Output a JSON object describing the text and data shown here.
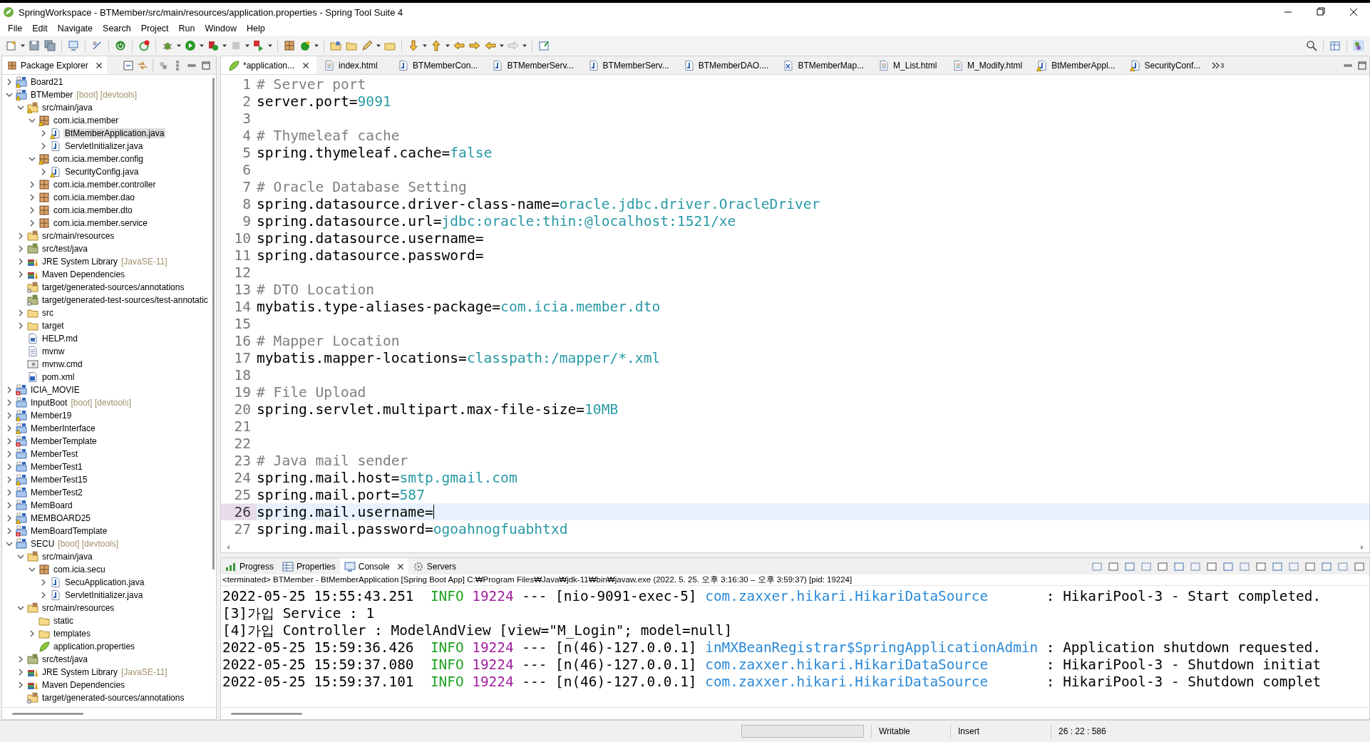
{
  "window": {
    "title": "SpringWorkspace - BTMember/src/main/resources/application.properties - Spring Tool Suite 4"
  },
  "menu": [
    "File",
    "Edit",
    "Navigate",
    "Search",
    "Project",
    "Run",
    "Window",
    "Help"
  ],
  "package_explorer": {
    "title": "Package Explorer",
    "tree": [
      {
        "label": "Board21",
        "kind": "project",
        "warning": true,
        "expanded": false,
        "selected": false
      },
      {
        "label": "BTMember",
        "decoration": "[boot] [devtools]",
        "kind": "project",
        "warning": true,
        "expanded": true,
        "selected": false,
        "children": [
          {
            "label": "src/main/java",
            "kind": "src-folder",
            "warning": true,
            "expanded": true,
            "selected": false,
            "children": [
              {
                "label": "com.icia.member",
                "kind": "package",
                "warning": true,
                "expanded": true,
                "selected": false,
                "children": [
                  {
                    "label": "BtMemberApplication.java",
                    "kind": "java",
                    "warning": true,
                    "expanded": false,
                    "selected": true
                  },
                  {
                    "label": "ServletInitializer.java",
                    "kind": "java",
                    "expanded": false,
                    "selected": false
                  }
                ]
              },
              {
                "label": "com.icia.member.config",
                "kind": "package",
                "warning": true,
                "expanded": true,
                "selected": false,
                "children": [
                  {
                    "label": "SecurityConfig.java",
                    "kind": "java",
                    "warning": true,
                    "expanded": false,
                    "selected": false
                  }
                ]
              },
              {
                "label": "com.icia.member.controller",
                "kind": "package",
                "expanded": false,
                "selected": false
              },
              {
                "label": "com.icia.member.dao",
                "kind": "package",
                "expanded": false,
                "selected": false
              },
              {
                "label": "com.icia.member.dto",
                "kind": "package",
                "expanded": false,
                "selected": false
              },
              {
                "label": "com.icia.member.service",
                "kind": "package",
                "expanded": false,
                "selected": false
              }
            ]
          },
          {
            "label": "src/main/resources",
            "kind": "src-folder",
            "expanded": false,
            "selected": false
          },
          {
            "label": "src/test/java",
            "kind": "test-folder",
            "expanded": false,
            "selected": false
          },
          {
            "label": "JRE System Library",
            "decoration": "[JavaSE-11]",
            "kind": "library",
            "expanded": false,
            "selected": false
          },
          {
            "label": "Maven Dependencies",
            "kind": "library",
            "expanded": false,
            "selected": false
          },
          {
            "label": "target/generated-sources/annotations",
            "kind": "gen-folder",
            "selected": false
          },
          {
            "label": "target/generated-test-sources/test-annotatic",
            "kind": "gen-test-folder",
            "selected": false
          },
          {
            "label": "src",
            "kind": "folder",
            "expanded": false,
            "selected": false
          },
          {
            "label": "target",
            "kind": "folder",
            "expanded": false,
            "selected": false
          },
          {
            "label": "HELP.md",
            "kind": "doc",
            "selected": false
          },
          {
            "label": "mvnw",
            "kind": "file",
            "selected": false
          },
          {
            "label": "mvnw.cmd",
            "kind": "cmd",
            "selected": false
          },
          {
            "label": "pom.xml",
            "kind": "pom",
            "selected": false
          }
        ]
      },
      {
        "label": "ICIA_MOVIE",
        "kind": "project",
        "error": true,
        "expanded": false,
        "selected": false
      },
      {
        "label": "InputBoot",
        "decoration": "[boot] [devtools]",
        "kind": "project",
        "expanded": false,
        "selected": false
      },
      {
        "label": "Member19",
        "kind": "project",
        "warning": true,
        "expanded": false,
        "selected": false
      },
      {
        "label": "MemberInterface",
        "kind": "project",
        "warning": true,
        "expanded": false,
        "selected": false
      },
      {
        "label": "MemberTemplate",
        "kind": "project",
        "error": true,
        "expanded": false,
        "selected": false
      },
      {
        "label": "MemberTest",
        "kind": "project",
        "expanded": false,
        "selected": false
      },
      {
        "label": "MemberTest1",
        "kind": "project",
        "expanded": false,
        "selected": false
      },
      {
        "label": "MemberTest15",
        "kind": "project",
        "warning": true,
        "expanded": false,
        "selected": false
      },
      {
        "label": "MemberTest2",
        "kind": "project",
        "expanded": false,
        "selected": false
      },
      {
        "label": "MemBoard",
        "kind": "project",
        "expanded": false,
        "selected": false
      },
      {
        "label": "MEMBOARD25",
        "kind": "project",
        "warning": true,
        "expanded": false,
        "selected": false
      },
      {
        "label": "MemBoardTemplate",
        "kind": "project",
        "error": true,
        "expanded": false,
        "selected": false
      },
      {
        "label": "SECU",
        "decoration": "[boot] [devtools]",
        "kind": "project",
        "expanded": true,
        "selected": false,
        "children": [
          {
            "label": "src/main/java",
            "kind": "src-folder",
            "expanded": true,
            "selected": false,
            "children": [
              {
                "label": "com.icia.secu",
                "kind": "package",
                "expanded": true,
                "selected": false,
                "children": [
                  {
                    "label": "SecuApplication.java",
                    "kind": "java",
                    "expanded": false,
                    "selected": false
                  },
                  {
                    "label": "ServletInitializer.java",
                    "kind": "java",
                    "expanded": false,
                    "selected": false
                  }
                ]
              }
            ]
          },
          {
            "label": "src/main/resources",
            "kind": "src-folder",
            "expanded": true,
            "selected": false,
            "children": [
              {
                "label": "static",
                "kind": "folder",
                "selected": false
              },
              {
                "label": "templates",
                "kind": "folder",
                "expanded": false,
                "selected": false
              },
              {
                "label": "application.properties",
                "kind": "leaf",
                "selected": false
              }
            ]
          },
          {
            "label": "src/test/java",
            "kind": "test-folder",
            "expanded": false,
            "selected": false
          },
          {
            "label": "JRE System Library",
            "decoration": "[JavaSE-11]",
            "kind": "library",
            "expanded": false,
            "selected": false
          },
          {
            "label": "Maven Dependencies",
            "kind": "library",
            "expanded": false,
            "selected": false
          },
          {
            "label": "target/generated-sources/annotations",
            "kind": "gen-folder",
            "selected": false
          }
        ]
      }
    ]
  },
  "editor": {
    "tabs": [
      {
        "label": "*application...",
        "kind": "leaf",
        "selected": true
      },
      {
        "label": "index.html",
        "kind": "html",
        "selected": false
      },
      {
        "label": "BTMemberCon...",
        "kind": "java",
        "selected": false
      },
      {
        "label": "BTMemberServ...",
        "kind": "java",
        "selected": false
      },
      {
        "label": "BTMemberServ...",
        "kind": "java",
        "selected": false
      },
      {
        "label": "BTMemberDAO....",
        "kind": "java",
        "selected": false
      },
      {
        "label": "BTMemberMap...",
        "kind": "xml",
        "selected": false
      },
      {
        "label": "M_List.html",
        "kind": "html",
        "selected": false
      },
      {
        "label": "M_Modify.html",
        "kind": "html",
        "selected": false
      },
      {
        "label": "BtMemberAppl...",
        "kind": "java",
        "warning": true,
        "selected": false
      },
      {
        "label": "SecurityConf...",
        "kind": "java",
        "warning": true,
        "selected": false
      }
    ],
    "overflow": "3",
    "lines": [
      {
        "number": "1",
        "kind": "comment",
        "text": "# Server port",
        "current": false
      },
      {
        "number": "2",
        "kind": "property",
        "key": "server.port=",
        "value": "9091",
        "current": false
      },
      {
        "number": "3",
        "kind": "blank",
        "current": false
      },
      {
        "number": "4",
        "kind": "comment",
        "text": "# Thymeleaf cache",
        "current": false
      },
      {
        "number": "5",
        "kind": "property",
        "key": "spring.thymeleaf.cache=",
        "value": "false",
        "current": false
      },
      {
        "number": "6",
        "kind": "blank",
        "current": false
      },
      {
        "number": "7",
        "kind": "comment",
        "text": "# Oracle Database Setting",
        "current": false
      },
      {
        "number": "8",
        "kind": "property",
        "key": "spring.datasource.driver-class-name=",
        "value": "oracle.jdbc.driver.OracleDriver",
        "current": false
      },
      {
        "number": "9",
        "kind": "property",
        "key": "spring.datasource.url=",
        "value": "jdbc:oracle:thin:@localhost:1521/xe",
        "current": false
      },
      {
        "number": "10",
        "kind": "property",
        "key": "spring.datasource.username=",
        "current": false
      },
      {
        "number": "11",
        "kind": "property",
        "key": "spring.datasource.password=",
        "current": false
      },
      {
        "number": "12",
        "kind": "blank",
        "current": false
      },
      {
        "number": "13",
        "kind": "comment",
        "text": "# DTO Location",
        "current": false
      },
      {
        "number": "14",
        "kind": "property",
        "key": "mybatis.type-aliases-package=",
        "value": "com.icia.member.dto",
        "current": false
      },
      {
        "number": "15",
        "kind": "blank",
        "current": false
      },
      {
        "number": "16",
        "kind": "comment",
        "text": "# Mapper Location",
        "current": false
      },
      {
        "number": "17",
        "kind": "property",
        "key": "mybatis.mapper-locations=",
        "value": "classpath:/mapper/*.xml",
        "current": false
      },
      {
        "number": "18",
        "kind": "blank",
        "current": false
      },
      {
        "number": "19",
        "kind": "comment",
        "text": "# File Upload",
        "current": false
      },
      {
        "number": "20",
        "kind": "property",
        "key": "spring.servlet.multipart.max-file-size=",
        "value": "10MB",
        "current": false
      },
      {
        "number": "21",
        "kind": "blank",
        "current": false
      },
      {
        "number": "22",
        "kind": "blank",
        "current": false
      },
      {
        "number": "23",
        "kind": "comment",
        "text": "# Java mail sender",
        "current": false
      },
      {
        "number": "24",
        "kind": "property",
        "key": "spring.mail.host=",
        "value": "smtp.gmail.com",
        "current": false
      },
      {
        "number": "25",
        "kind": "property",
        "key": "spring.mail.port=",
        "value": "587",
        "current": false
      },
      {
        "number": "26",
        "kind": "property",
        "key": "spring.mail.username=",
        "current": true
      },
      {
        "number": "27",
        "kind": "property",
        "key": "spring.mail.password=",
        "value": "ogoahnogfuabhtxd",
        "current": false
      }
    ]
  },
  "console": {
    "tabs": [
      {
        "label": "Progress",
        "kind": "progress",
        "selected": false
      },
      {
        "label": "Properties",
        "kind": "properties",
        "selected": false
      },
      {
        "label": "Console",
        "kind": "console",
        "selected": true
      },
      {
        "label": "Servers",
        "kind": "servers",
        "selected": false
      }
    ],
    "header": "<terminated> BTMember - BtMemberApplication [Spring Boot App] C:₩Program Files₩Java₩jdk-11₩bin₩javaw.exe  (2022. 5. 25. 오후 3:16:30 – 오후 3:59:37) [pid: 19224]",
    "lines": [
      {
        "kind": "log",
        "time": "2022-05-25 15:55:43.251",
        "level": "INFO",
        "pid": "19224",
        "sep": "---",
        "thread": "[nio-9091-exec-5]",
        "logger": "com.zaxxer.hikari.HikariDataSource",
        "message": ": HikariPool-3 - Start completed."
      },
      {
        "kind": "plain",
        "text": "[3]가입 Service : 1"
      },
      {
        "kind": "plain",
        "text": "[4]가입 Controller : ModelAndView [view=\"M_Login\"; model=null]"
      },
      {
        "kind": "log",
        "time": "2022-05-25 15:59:36.426",
        "level": "INFO",
        "pid": "19224",
        "sep": "---",
        "thread": "[n(46)-127.0.0.1]",
        "logger": "inMXBeanRegistrar$SpringApplicationAdmin",
        "message": ": Application shutdown requested."
      },
      {
        "kind": "log",
        "time": "2022-05-25 15:59:37.080",
        "level": "INFO",
        "pid": "19224",
        "sep": "---",
        "thread": "[n(46)-127.0.0.1]",
        "logger": "com.zaxxer.hikari.HikariDataSource",
        "message": ": HikariPool-3 - Shutdown initiat"
      },
      {
        "kind": "log",
        "time": "2022-05-25 15:59:37.101",
        "level": "INFO",
        "pid": "19224",
        "sep": "---",
        "thread": "[n(46)-127.0.0.1]",
        "logger": "com.zaxxer.hikari.HikariDataSource",
        "message": ": HikariPool-3 - Shutdown complet"
      }
    ]
  },
  "status_bar": {
    "mode": "Writable",
    "insert_mode": "Insert",
    "position": "26 : 22 : 586"
  }
}
